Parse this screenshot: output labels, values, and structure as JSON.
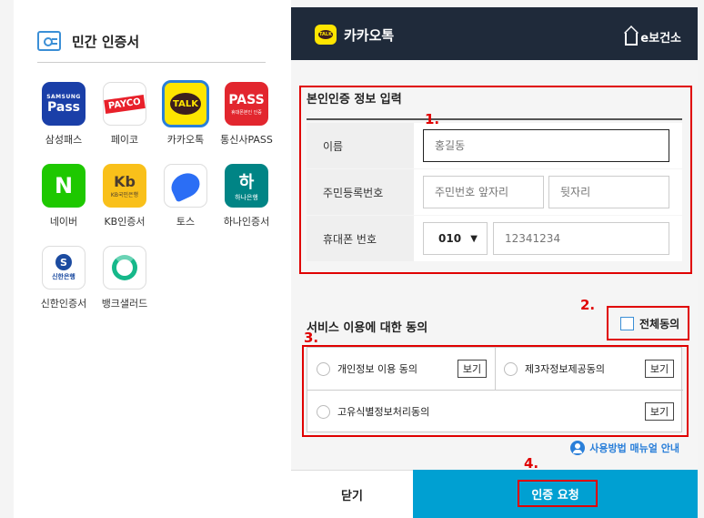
{
  "left": {
    "title": "민간 인증서",
    "providers": [
      {
        "label": "삼성패스",
        "logo_text": [
          "SAMSUNG",
          "Pass"
        ]
      },
      {
        "label": "페이코",
        "logo_text": [
          "PAYCO"
        ]
      },
      {
        "label": "카카오톡",
        "logo_text": [
          "TALK"
        ]
      },
      {
        "label": "통신사PASS",
        "logo_text": [
          "PASS",
          "휴대폰본인 인증"
        ]
      },
      {
        "label": "네이버",
        "logo_text": [
          "N"
        ]
      },
      {
        "label": "KB인증서",
        "logo_text": [
          "Kb",
          "KB국민은행"
        ]
      },
      {
        "label": "토스",
        "logo_text": []
      },
      {
        "label": "하나인증서",
        "logo_text": [
          "하",
          "하나은행"
        ]
      },
      {
        "label": "신한인증서",
        "logo_text": [
          "S",
          "신한은행"
        ]
      },
      {
        "label": "뱅크샐러드",
        "logo_text": []
      }
    ]
  },
  "right": {
    "header_title": "카카오톡",
    "header_brand": "e보건소",
    "form_title": "본인인증 정보 입력",
    "form": {
      "name_label": "이름",
      "name_placeholder": "홍길동",
      "rrn_label": "주민등록번호",
      "rrn_front_placeholder": "주민번호 앞자리",
      "rrn_back_placeholder": "뒷자리",
      "phone_label": "휴대폰 번호",
      "phone_prefix": "010",
      "phone_placeholder": "12341234"
    },
    "agree_title": "서비스 이용에 대한 동의",
    "agree_all": "전체동의",
    "agreements": [
      {
        "label": "개인정보 이용 동의",
        "view": "보기"
      },
      {
        "label": "제3자정보제공동의",
        "view": "보기"
      },
      {
        "label": "고유식별정보처리동의",
        "view": "보기"
      }
    ],
    "manual_link": "사용방법 매뉴얼 안내",
    "close_button": "닫기",
    "request_button": "인증 요청"
  },
  "annotations": [
    "1.",
    "2.",
    "3.",
    "4."
  ],
  "colors": {
    "header_bg": "#1f2a3a",
    "request_bg": "#00a0d2",
    "annotation_red": "#e00000",
    "kakao_yellow": "#fee500"
  }
}
